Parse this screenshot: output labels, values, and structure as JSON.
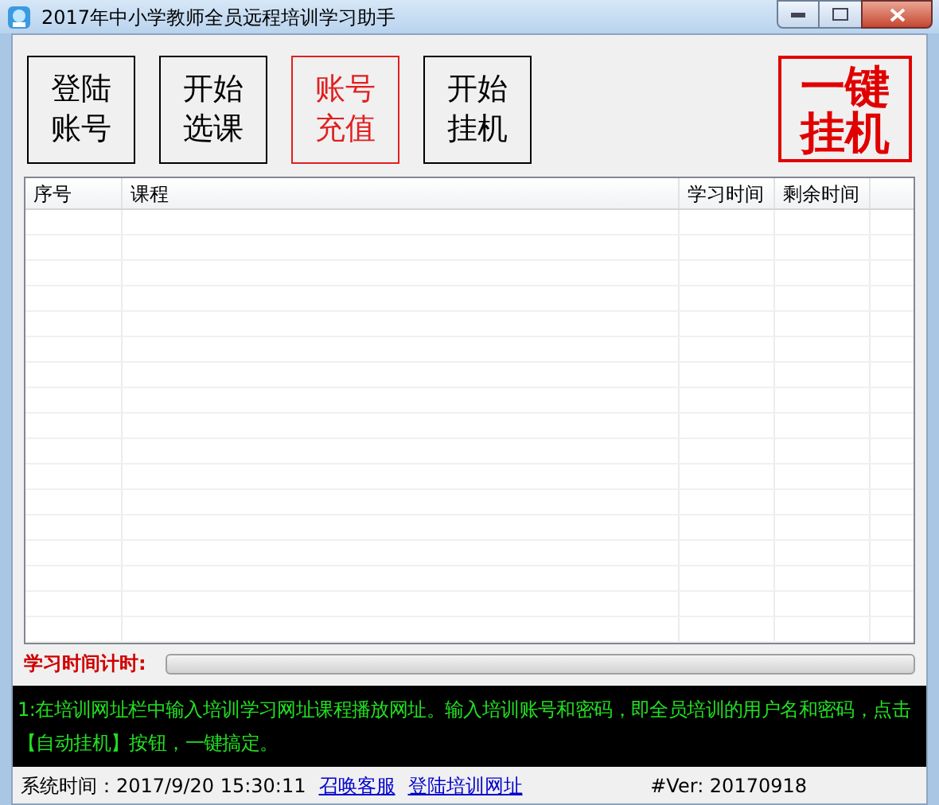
{
  "window": {
    "title": "2017年中小学教师全员远程培训学习助手"
  },
  "buttons": [
    {
      "label": "登陆账号",
      "highlight": false
    },
    {
      "label": "开始选课",
      "highlight": false
    },
    {
      "label": "账号充值",
      "highlight": true
    },
    {
      "label": "开始挂机",
      "highlight": false
    }
  ],
  "big_button": {
    "label": "一键挂机"
  },
  "table": {
    "columns": [
      "序号",
      "课程",
      "学习时间",
      "剩余时间"
    ]
  },
  "timer": {
    "label": "学习时间计时:",
    "level": 0
  },
  "log": {
    "lines": [
      "1:在培训网址栏中输入培训学习网址课程播放网址。输入培训账号和密码，即全员培训的用户名和密码，点击",
      "【自动挂机】按钮，一键搞定。"
    ]
  },
  "status_bar": {
    "time": "系统时间：2017/9/20 15:30:11",
    "links": [
      "召唤客服",
      "登陆培训网址"
    ],
    "version": "#Ver: 20170918"
  }
}
